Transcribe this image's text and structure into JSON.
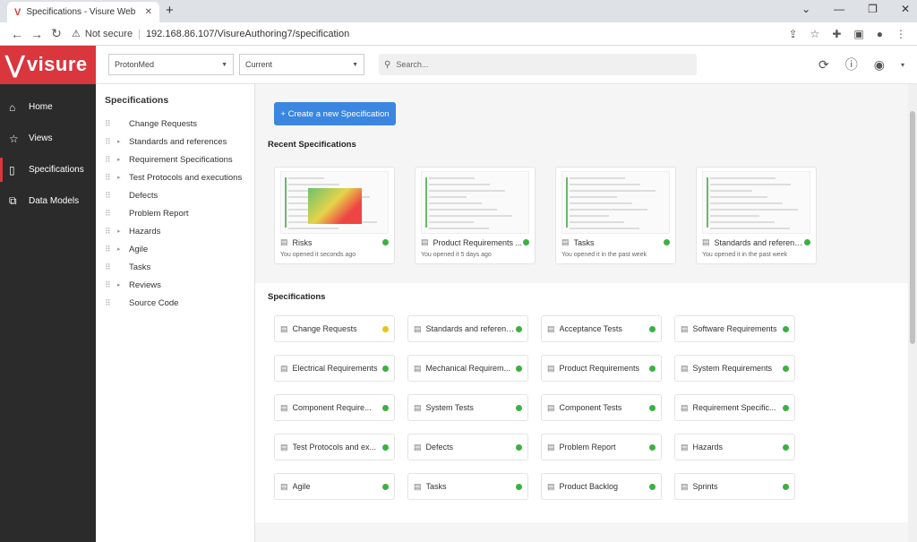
{
  "browser": {
    "tab_title": "Specifications - Visure Web",
    "tab_favicon": "V",
    "not_secure": "Not secure",
    "url": "192.168.86.107/VisureAuthoring7/specification"
  },
  "header": {
    "logo_text": "visure",
    "project_select": "ProtonMed",
    "version_select": "Current",
    "search_placeholder": "Search..."
  },
  "sidebar": {
    "items": [
      {
        "label": "Home",
        "icon": "home-icon"
      },
      {
        "label": "Views",
        "icon": "star-icon"
      },
      {
        "label": "Specifications",
        "icon": "document-icon"
      },
      {
        "label": "Data Models",
        "icon": "model-icon"
      }
    ]
  },
  "tree": {
    "title": "Specifications",
    "items": [
      {
        "label": "Change Requests",
        "expandable": false
      },
      {
        "label": "Standards and references",
        "expandable": true
      },
      {
        "label": "Requirement Specifications",
        "expandable": true
      },
      {
        "label": "Test Protocols and executions",
        "expandable": true
      },
      {
        "label": "Defects",
        "expandable": false
      },
      {
        "label": "Problem Report",
        "expandable": false
      },
      {
        "label": "Hazards",
        "expandable": true
      },
      {
        "label": "Agile",
        "expandable": true
      },
      {
        "label": "Tasks",
        "expandable": false
      },
      {
        "label": "Reviews",
        "expandable": true
      },
      {
        "label": "Source Code",
        "expandable": false
      }
    ]
  },
  "main": {
    "create_button": "+ Create a new Specification",
    "recent_title": "Recent Specifications",
    "recent": [
      {
        "name": "Risks",
        "opened": "You opened it seconds ago",
        "status": "#3cb043"
      },
      {
        "name": "Product Requirements ...",
        "opened": "You opened it 5 days ago",
        "status": "#3cb043"
      },
      {
        "name": "Tasks",
        "opened": "You opened it in the past week",
        "status": "#3cb043"
      },
      {
        "name": "Standards and references",
        "opened": "You opened it in the past week",
        "status": "#3cb043"
      }
    ],
    "specs_title": "Specifications",
    "specs": [
      {
        "name": "Change Requests",
        "status": "#e6c419"
      },
      {
        "name": "Standards and references",
        "status": "#3cb043"
      },
      {
        "name": "Acceptance Tests",
        "status": "#3cb043"
      },
      {
        "name": "Software Requirements",
        "status": "#3cb043"
      },
      {
        "name": "Electrical Requirements",
        "status": "#3cb043"
      },
      {
        "name": "Mechanical Requirem...",
        "status": "#3cb043"
      },
      {
        "name": "Product Requirements",
        "status": "#3cb043"
      },
      {
        "name": "System Requirements",
        "status": "#3cb043"
      },
      {
        "name": "Component Require...",
        "status": "#3cb043"
      },
      {
        "name": "System Tests",
        "status": "#3cb043"
      },
      {
        "name": "Component Tests",
        "status": "#3cb043"
      },
      {
        "name": "Requirement Specific...",
        "status": "#3cb043"
      },
      {
        "name": "Test Protocols and ex...",
        "status": "#3cb043"
      },
      {
        "name": "Defects",
        "status": "#3cb043"
      },
      {
        "name": "Problem Report",
        "status": "#3cb043"
      },
      {
        "name": "Hazards",
        "status": "#3cb043"
      },
      {
        "name": "Agile",
        "status": "#3cb043"
      },
      {
        "name": "Tasks",
        "status": "#3cb043"
      },
      {
        "name": "Product Backlog",
        "status": "#3cb043"
      },
      {
        "name": "Sprints",
        "status": "#3cb043"
      }
    ]
  },
  "colors": {
    "brand": "#d9363e",
    "sidebar_bg": "#2b2b2b",
    "button_blue": "#3a86e0"
  }
}
